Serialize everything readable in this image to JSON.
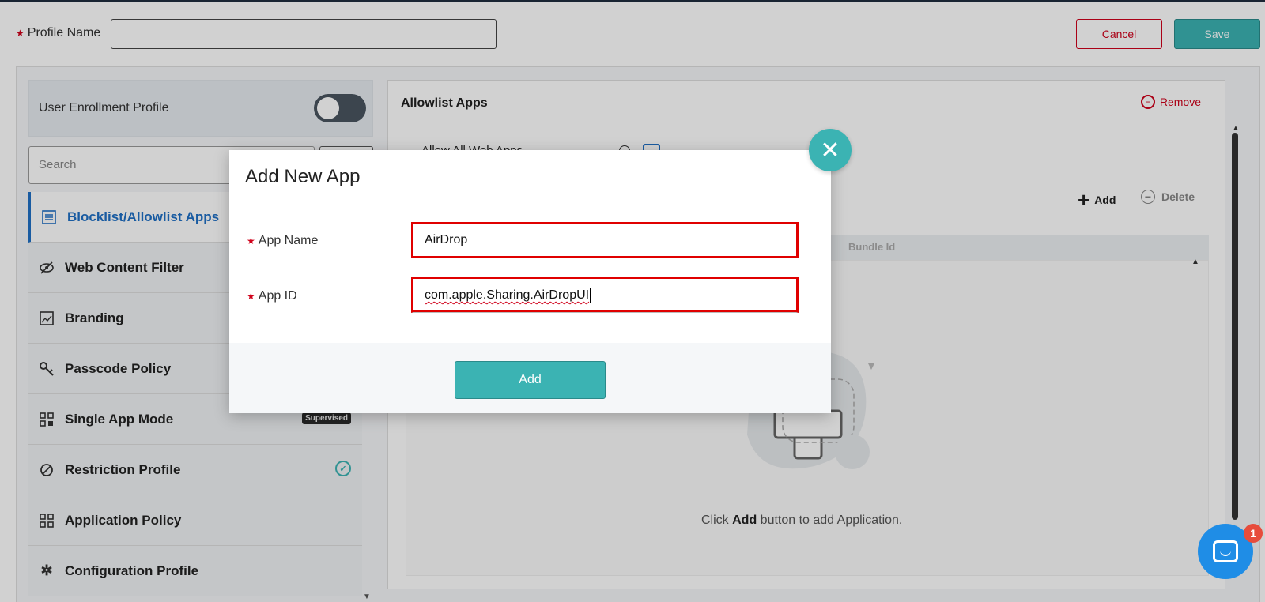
{
  "header": {
    "profile_name_label": "Profile Name",
    "profile_name_value": "",
    "cancel_label": "Cancel",
    "save_label": "Save"
  },
  "sidebar": {
    "user_enrollment_label": "User Enrollment Profile",
    "user_enrollment_enabled": false,
    "search_placeholder": "Search",
    "items": [
      {
        "label": "Blocklist/Allowlist Apps",
        "icon": "list-icon",
        "active": true
      },
      {
        "label": "Web Content Filter",
        "icon": "eye-off-icon"
      },
      {
        "label": "Branding",
        "icon": "image-icon"
      },
      {
        "label": "Passcode Policy",
        "icon": "key-icon"
      },
      {
        "label": "Single App Mode",
        "icon": "grid-icon",
        "badge": "Supervised"
      },
      {
        "label": "Restriction Profile",
        "icon": "block-icon",
        "status": "check-circle-icon"
      },
      {
        "label": "Application Policy",
        "icon": "apps-icon"
      },
      {
        "label": "Configuration Profile",
        "icon": "gear-icon"
      }
    ]
  },
  "main": {
    "title": "Allowlist Apps",
    "remove_label": "Remove",
    "allow_web_label": "Allow All Web Apps",
    "add_label": "Add",
    "delete_label": "Delete",
    "table_column": "Bundle Id",
    "empty_prefix": "Click ",
    "empty_bold": "Add",
    "empty_suffix": " button to add Application."
  },
  "modal": {
    "title": "Add New App",
    "app_name_label": "App Name",
    "app_name_value": "AirDrop",
    "app_id_label": "App ID",
    "app_id_value": "com.apple.Sharing.AirDropUI",
    "add_label": "Add"
  },
  "chat": {
    "unread_count": "1"
  },
  "colors": {
    "accent": "#3bb3b3",
    "danger": "#d0021b",
    "active_link": "#1f6fc5",
    "chat": "#1f8de6"
  }
}
